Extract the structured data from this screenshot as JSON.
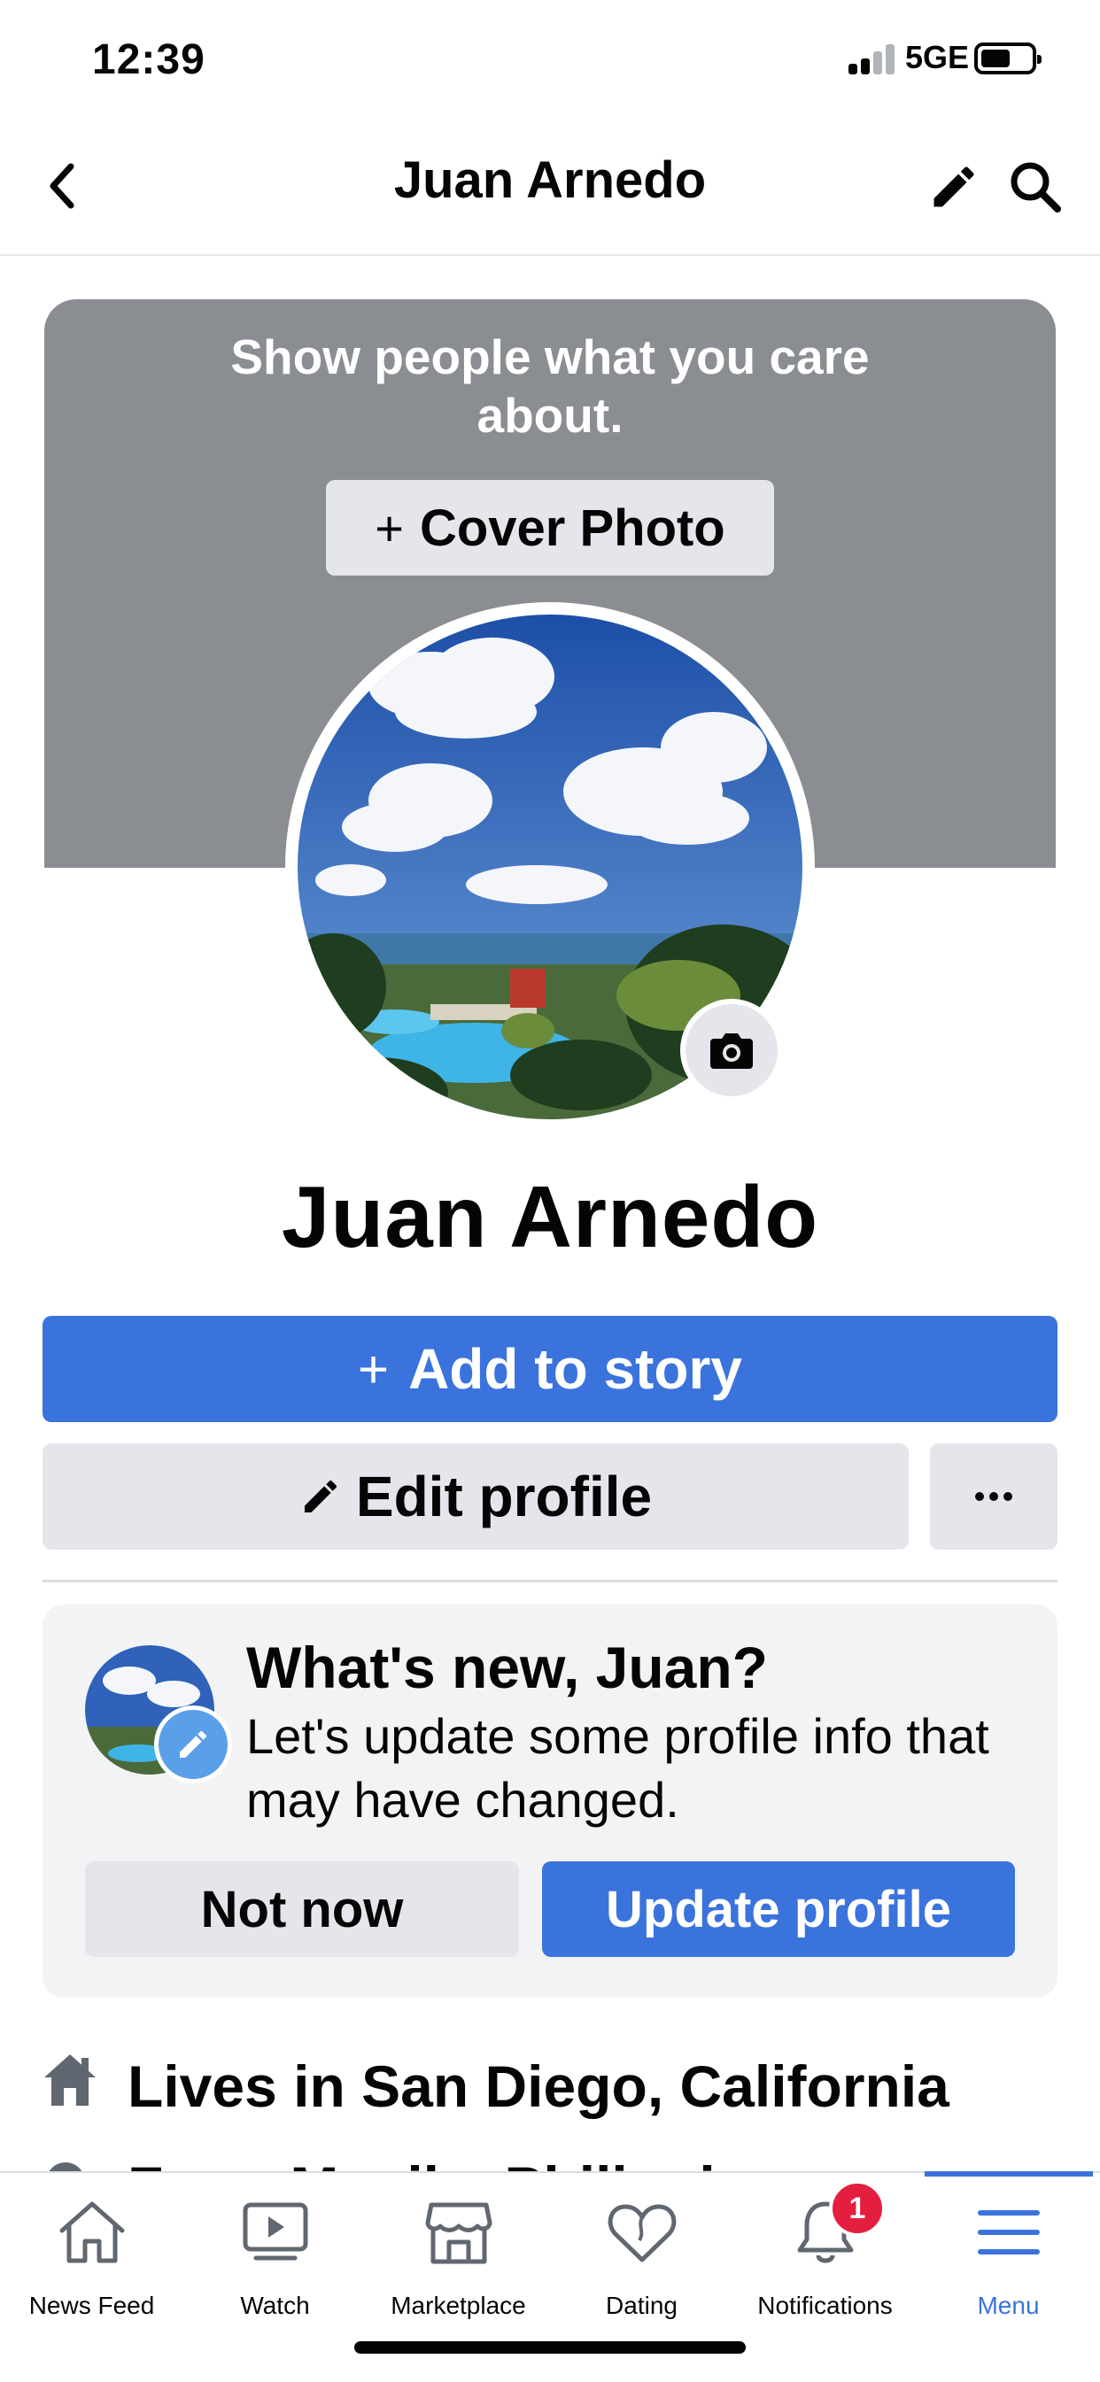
{
  "status_bar": {
    "time": "12:39",
    "network": "5GE"
  },
  "nav": {
    "title": "Juan Arnedo"
  },
  "cover": {
    "prompt": "Show people what you care about.",
    "button_label": "Cover Photo",
    "button_plus": "+"
  },
  "profile": {
    "name": "Juan Arnedo"
  },
  "actions": {
    "add_story_plus": "+",
    "add_story": "Add to story",
    "edit_profile": "Edit profile"
  },
  "whats_new": {
    "title": "What's new, Juan?",
    "body": "Let's update some profile info that may have changed.",
    "not_now": "Not now",
    "update": "Update profile"
  },
  "intro": {
    "lives_in": "Lives in San Diego, California",
    "from": "From Manila, Philippines"
  },
  "tabbar": {
    "tabs": [
      {
        "label": "News Feed",
        "icon": "home-icon"
      },
      {
        "label": "Watch",
        "icon": "watch-icon"
      },
      {
        "label": "Marketplace",
        "icon": "marketplace-icon"
      },
      {
        "label": "Dating",
        "icon": "heart-icon"
      },
      {
        "label": "Notifications",
        "icon": "bell-icon"
      },
      {
        "label": "Menu",
        "icon": "menu-icon"
      }
    ],
    "notification_count": "1",
    "active": "Menu"
  },
  "colors": {
    "brand_blue": "#3b73dd",
    "cover_gray": "#8a8d91",
    "button_gray": "#e4e6eb",
    "badge_red": "#e41e3f"
  }
}
